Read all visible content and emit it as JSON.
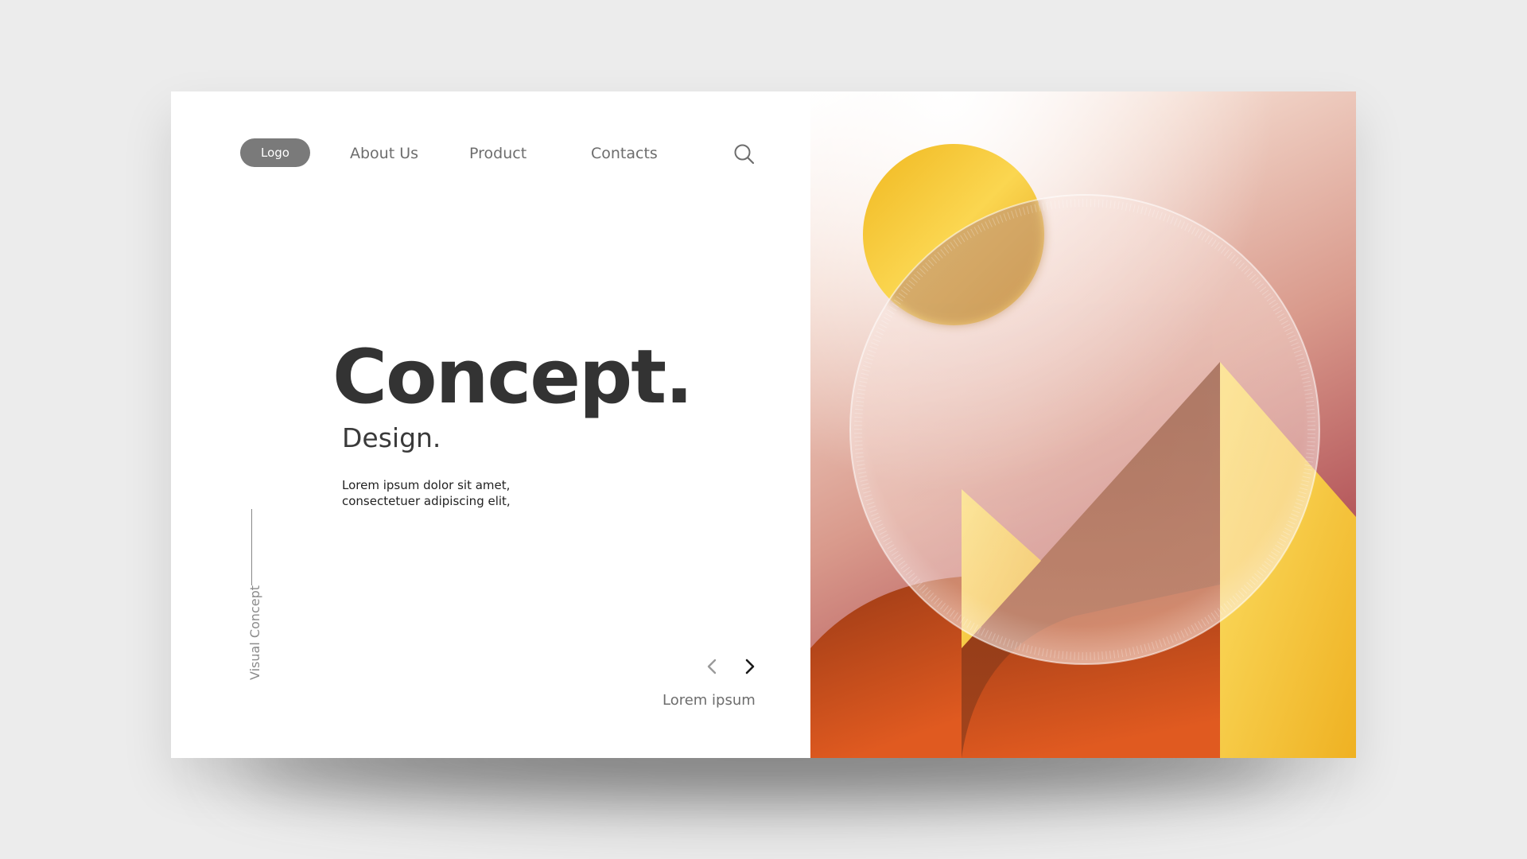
{
  "nav": {
    "logo": "Logo",
    "links": [
      "About Us",
      "Product",
      "Contacts"
    ],
    "search_icon": "search-icon"
  },
  "hero": {
    "title": "Concept.",
    "subtitle": "Design.",
    "body_lines": [
      "Lorem ipsum dolor sit amet,",
      "consectetuer adipiscing elit,"
    ]
  },
  "side": {
    "label": "Visual Concept"
  },
  "slider": {
    "prev_icon": "chevron-left-icon",
    "next_icon": "chevron-right-icon",
    "caption": "Lorem ipsum"
  },
  "colors": {
    "page_bg": "#ececec",
    "card_bg": "#ffffff",
    "title": "#333333",
    "nav_text": "#6d6d6d",
    "logo_bg": "#7a7a7a",
    "sun": "#f5c030",
    "mountain_dark": "#8a3a1a",
    "mountain_yellow": "#f7cf40",
    "mountain_orange": "#d8501f"
  }
}
